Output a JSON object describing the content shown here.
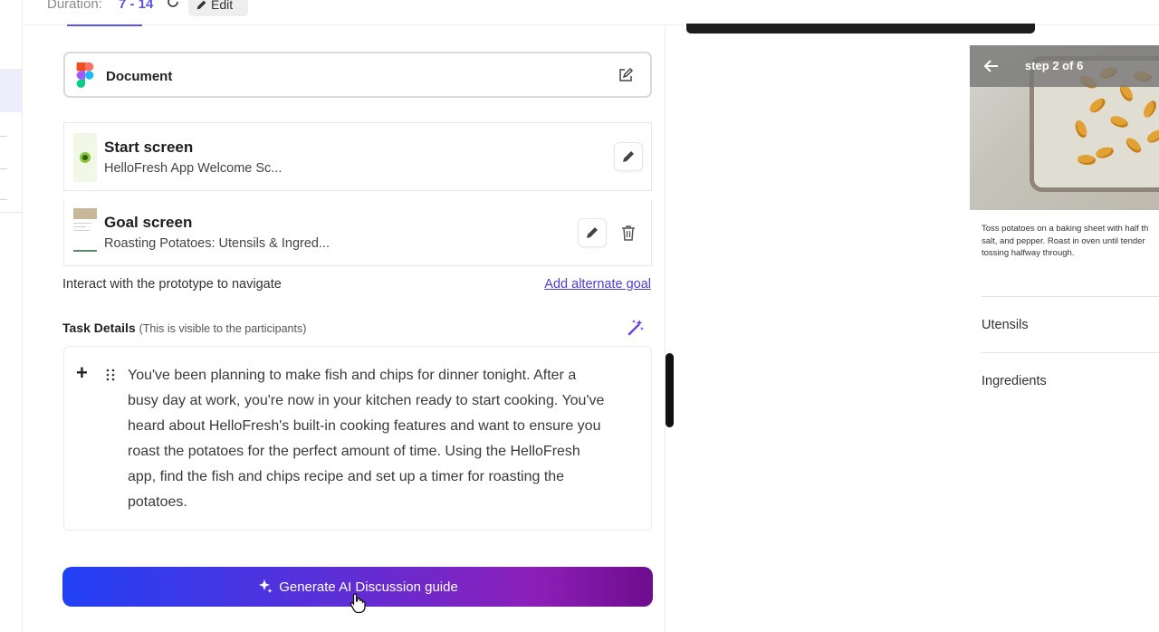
{
  "topbar": {
    "duration_label": "Duration:",
    "duration_value": "7 - 14",
    "edit_label": "Edit"
  },
  "document": {
    "title": "Document"
  },
  "start_screen": {
    "title": "Start screen",
    "subtitle": "HelloFresh App Welcome Sc..."
  },
  "goal_screen": {
    "title": "Goal screen",
    "subtitle": "Roasting Potatoes: Utensils & Ingred..."
  },
  "hint": "Interact with the prototype to navigate",
  "add_alternate_goal": "Add alternate goal",
  "task": {
    "label": "Task Details",
    "note": "(This is visible to the participants)",
    "text": "You've been planning to make fish and chips for dinner tonight. After a busy day at work, you're now in your kitchen ready to start cooking. You've heard about HelloFresh's built-in cooking features and want to ensure you roast the potatoes for the perfect amount of time. Using the HelloFresh app, find the fish and chips recipe and set up a timer for roasting the potatoes."
  },
  "generate_button": "Generate AI Discussion guide",
  "preview": {
    "step": "step 2 of 6",
    "description": "Toss potatoes on a baking sheet with half th\nsalt, and pepper. Roast in oven until tender\ntossing halfway through.",
    "sections": [
      "Utensils",
      "Ingredients"
    ]
  },
  "colors": {
    "accent": "#5a55e8",
    "link": "#4b3fd6",
    "button_gradient_start": "#2140f5",
    "button_gradient_end": "#6e0d8e"
  }
}
